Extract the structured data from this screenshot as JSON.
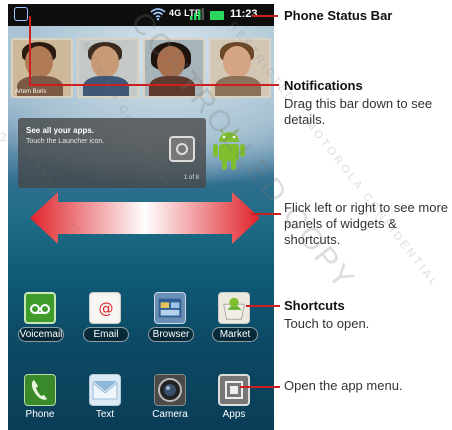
{
  "status_bar": {
    "network": "4G LTE",
    "time": "11:23",
    "battery_color": "#29d85d"
  },
  "photo_widget": {
    "caption": "Artem Boris"
  },
  "launcher_widget": {
    "title": "See all your apps.",
    "subtitle": "Touch the Launcher icon.",
    "page": "1 of 8"
  },
  "dock": {
    "row1": [
      {
        "label": "Voicemail",
        "icon": "voicemail-icon"
      },
      {
        "label": "Email",
        "icon": "email-icon"
      },
      {
        "label": "Browser",
        "icon": "browser-icon"
      },
      {
        "label": "Market",
        "icon": "market-icon"
      }
    ],
    "row2": [
      {
        "label": "Phone",
        "icon": "phone-icon"
      },
      {
        "label": "Text",
        "icon": "text-icon"
      },
      {
        "label": "Camera",
        "icon": "camera-icon"
      },
      {
        "label": "Apps",
        "icon": "apps-grid-icon"
      }
    ]
  },
  "callouts": {
    "status_bar": {
      "title": "Phone Status Bar"
    },
    "notifications": {
      "title": "Notifications",
      "body": "Drag this bar down to see details."
    },
    "flick": {
      "body": "Flick left or right to see more panels of widgets & shortcuts."
    },
    "shortcuts": {
      "title": "Shortcuts",
      "body": "Touch to open."
    },
    "app_menu": {
      "body": "Open the app menu."
    }
  },
  "watermarks": [
    "CONTROLLED COPY",
    "RESTRICTED :: MOTOROLA CONFIDENTIAL",
    "Motorola Confidential",
    "Confidential",
    "2011"
  ],
  "colors": {
    "callout_red": "#cc1f1f",
    "arrow_red": "#e0232a"
  }
}
